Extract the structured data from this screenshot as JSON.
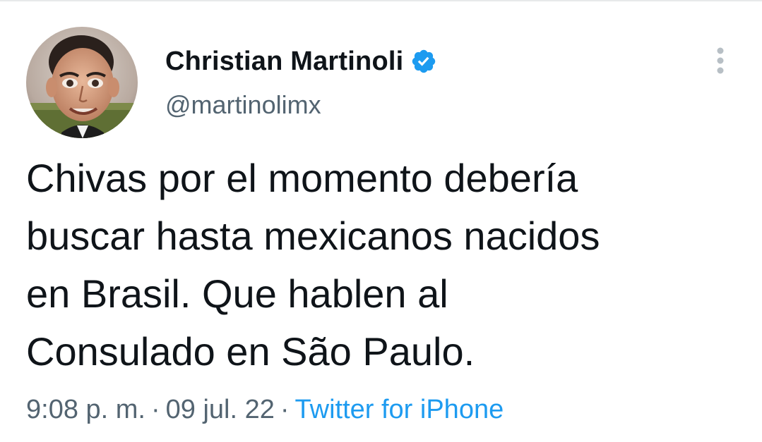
{
  "tweet": {
    "author": {
      "display_name": "Christian Martinoli",
      "handle": "@martinolimx",
      "verified": true
    },
    "text": "Chivas por el momento debería\nbuscar hasta mexicanos nacidos\nen Brasil. Que hablen al\nConsulado en São Paulo.",
    "time": "9:08 p. m.",
    "separator": "·",
    "date": "09 jul. 22",
    "source": "Twitter for iPhone"
  },
  "icons": {
    "verified": "verified-badge-icon",
    "more": "more-options-icon"
  },
  "colors": {
    "text_primary": "#0f1419",
    "text_secondary": "#536471",
    "accent": "#1d9bf0"
  }
}
